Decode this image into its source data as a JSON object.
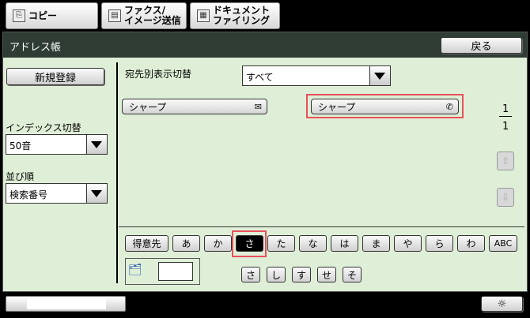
{
  "tabs": [
    {
      "label": "コピー",
      "icon": "copy-icon"
    },
    {
      "label": "ファクス/\nイメージ送信",
      "icon": "fax-icon"
    },
    {
      "label": "ドキュメント\nファイリング",
      "icon": "filing-icon"
    }
  ],
  "screen": {
    "title": "アドレス帳",
    "back_label": "戻る"
  },
  "left": {
    "new_register": "新規登録",
    "index_label": "インデックス切替",
    "index_value": "50音",
    "order_label": "並び順",
    "order_value": "検索番号"
  },
  "filter": {
    "label": "宛先別表示切替",
    "value": "すべて"
  },
  "addresses": [
    {
      "name": "シャープ",
      "icon": "email-icon",
      "glyph": "✉"
    },
    {
      "name": "シャープ",
      "icon": "phone-icon",
      "glyph": "✆"
    }
  ],
  "pager": {
    "current": "1",
    "total": "1"
  },
  "kana_row1": [
    "得意先",
    "あ",
    "か",
    "さ",
    "た",
    "な",
    "は",
    "ま",
    "や",
    "ら",
    "わ",
    "ABC"
  ],
  "kana_selected": "さ",
  "kana_row2": [
    "さ",
    "し",
    "す",
    "せ",
    "そ"
  ],
  "colors": {
    "screen_bg": "#dfefd7",
    "titlebar": "#2f3c34",
    "highlight": "#e8505b"
  }
}
